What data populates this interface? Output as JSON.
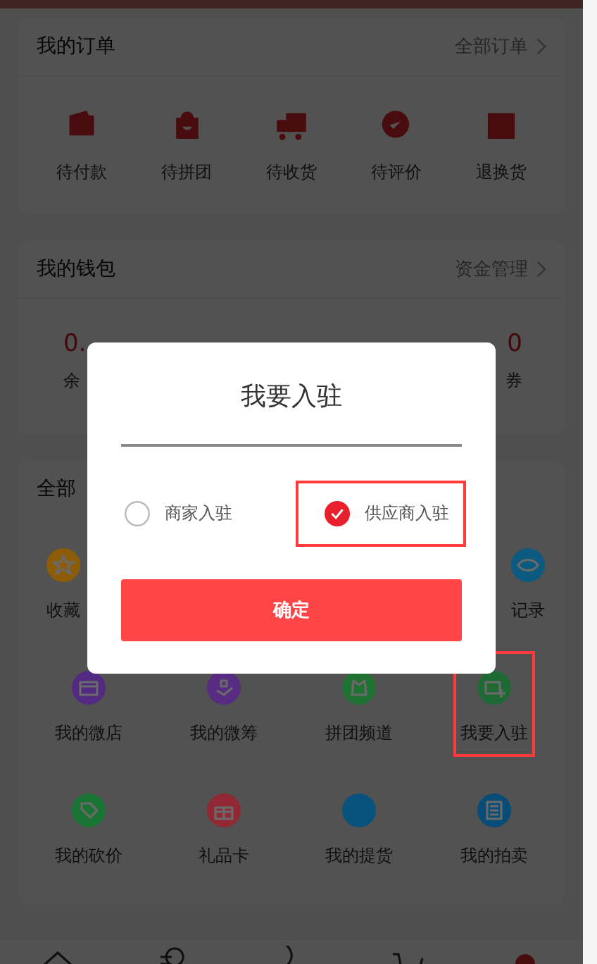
{
  "orders": {
    "title": "我的订单",
    "link": "全部订单",
    "items": [
      {
        "label": "待付款",
        "kind": "wallet"
      },
      {
        "label": "待拼团",
        "kind": "bag"
      },
      {
        "label": "待收货",
        "kind": "truck"
      },
      {
        "label": "待评价",
        "kind": "review"
      },
      {
        "label": "退换货",
        "kind": "box"
      }
    ]
  },
  "wallet": {
    "title": "我的钱包",
    "link": "资金管理",
    "items": [
      {
        "value": "0.",
        "label": "余"
      },
      {
        "value": "0",
        "label": "券"
      }
    ]
  },
  "tools": {
    "title": "全部",
    "rows": [
      [
        {
          "label": "收藏",
          "color": "#8c5c08",
          "kind": "star",
          "highlighted": false
        },
        "",
        "",
        {
          "label": "记录",
          "color": "#0c5a80",
          "kind": "eye",
          "highlighted": false
        }
      ],
      [
        {
          "label": "我的微店",
          "color": "#532a82",
          "kind": "shop",
          "highlighted": false
        },
        {
          "label": "我的微筹",
          "color": "#572c82",
          "kind": "hand",
          "highlighted": false
        },
        {
          "label": "拼团频道",
          "color": "#1f7232",
          "kind": "group",
          "highlighted": false
        },
        {
          "label": "我要入驻",
          "color": "#1f6a34",
          "kind": "card",
          "highlighted": true
        }
      ],
      [
        {
          "label": "我的砍价",
          "color": "#1a7434",
          "kind": "tag",
          "highlighted": false
        },
        {
          "label": "礼品卡",
          "color": "#922834",
          "kind": "gift",
          "highlighted": false
        },
        {
          "label": "我的提货",
          "color": "#08527e",
          "kind": "bag",
          "highlighted": false
        },
        {
          "label": "我的拍卖",
          "color": "#084c78",
          "kind": "list",
          "highlighted": false
        }
      ]
    ]
  },
  "modal": {
    "title": "我要入驻",
    "options": [
      {
        "label": "商家入驻",
        "selected": false,
        "highlighted": false
      },
      {
        "label": "供应商入驻",
        "selected": true,
        "highlighted": true
      }
    ],
    "confirm": "确定"
  },
  "nav": {
    "items": [
      {
        "kind": "home",
        "selected": false
      },
      {
        "kind": "category",
        "selected": false
      },
      {
        "kind": "chat",
        "selected": false
      },
      {
        "kind": "cart",
        "selected": false
      },
      {
        "kind": "user",
        "selected": true
      }
    ]
  }
}
